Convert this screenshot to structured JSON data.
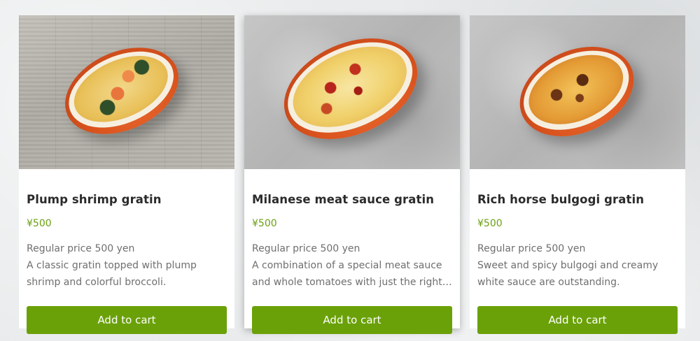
{
  "products": [
    {
      "name": "Plump shrimp gratin",
      "price": "¥500",
      "regular_price": "Regular price 500 yen",
      "description_lines": [
        "A classic gratin topped with plump",
        "shrimp and colorful broccoli."
      ],
      "button_label": "Add to cart",
      "image": "shrimp-gratin-photo"
    },
    {
      "name": "Milanese meat sauce gratin",
      "price": "¥500",
      "regular_price": "Regular price 500 yen",
      "description_lines": [
        "A combination of a special meat sauce",
        "and whole tomatoes with just the right…"
      ],
      "button_label": "Add to cart",
      "image": "meat-sauce-gratin-photo"
    },
    {
      "name": "Rich horse bulgogi gratin",
      "price": "¥500",
      "regular_price": "Regular price 500 yen",
      "description_lines": [
        "Sweet and spicy bulgogi and creamy",
        "white sauce are outstanding."
      ],
      "button_label": "Add to cart",
      "image": "bulgogi-gratin-photo"
    }
  ],
  "colors": {
    "accent": "#6aa108",
    "price": "#6a9f10",
    "title": "#2b2b2b",
    "text": "#6f6f6f"
  }
}
